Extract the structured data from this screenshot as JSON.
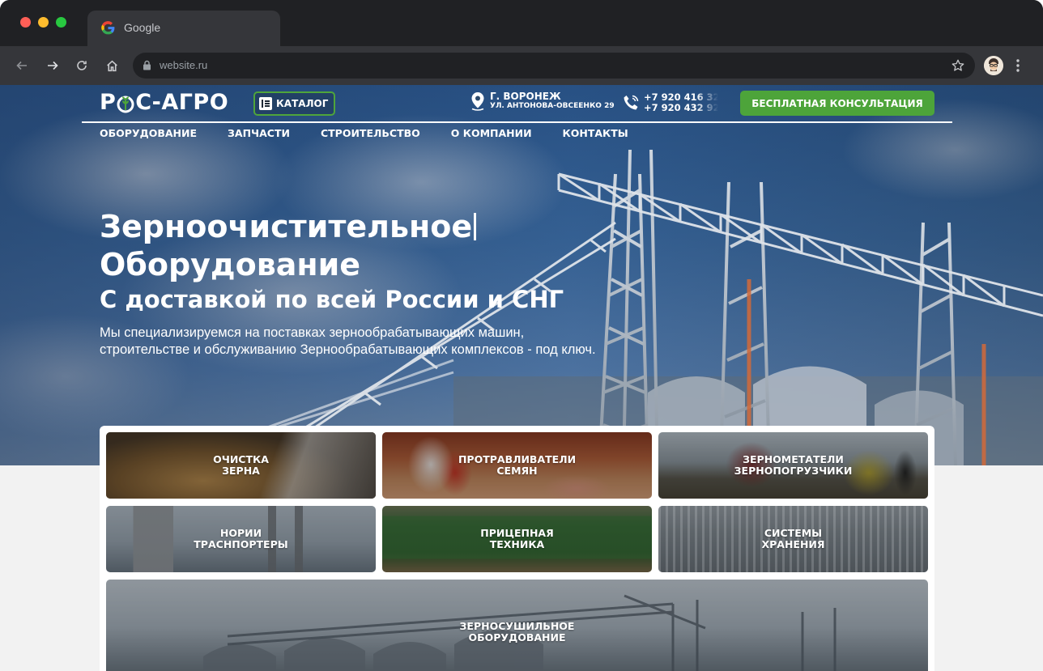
{
  "browser": {
    "tab_title": "Google",
    "url": "website.ru"
  },
  "site": {
    "logo_text_left": "Р",
    "logo_text_right": "С-АГРО",
    "catalog_label": "КАТАЛОГ",
    "address_city": "Г. ВОРОНЕЖ",
    "address_street": "УЛ. АНТОНОВА-ОВСЕЕНКО 29",
    "phone_1": "+7 920 416 323",
    "phone_2": "+7 920 432 929",
    "consult_label": "БЕСПЛАТНАЯ КОНСУЛЬТАЦИЯ",
    "nav": [
      {
        "label": "ОБОРУДОВАНИЕ"
      },
      {
        "label": "ЗАПЧАСТИ"
      },
      {
        "label": "СТРОИТЕЛЬСТВО"
      },
      {
        "label": "О КОМПАНИИ"
      },
      {
        "label": "КОНТАКТЫ"
      }
    ]
  },
  "hero": {
    "title_line1": "Зерноочистительное",
    "title_line2": "Оборудование",
    "subtitle": "С доставкой по всей России и СНГ",
    "lead_line1": "Мы специализируемся на поставках зернообрабатывающих машин,",
    "lead_line2": "строительстве и обслуживанию Зернообрабатывающих комплексов - под ключ."
  },
  "categories": [
    {
      "line1": "ОЧИСТКА",
      "line2": "ЗЕРНА"
    },
    {
      "line1": "ПРОТРАВЛИВАТЕЛИ",
      "line2": "СЕМЯН"
    },
    {
      "line1": "ЗЕРНОМЕТАТЕЛИ",
      "line2": "ЗЕРНОПОГРУЗЧИКИ"
    },
    {
      "line1": "НОРИИ",
      "line2": "ТРАСНПОРТЕРЫ"
    },
    {
      "line1": "ПРИЦЕПНАЯ",
      "line2": "ТЕХНИКА"
    },
    {
      "line1": "СИСТЕМЫ",
      "line2": "ХРАНЕНИЯ"
    },
    {
      "line1": "ЗЕРНОСУШИЛЬНОЕ",
      "line2": "ОБОРУДОВАНИЕ"
    }
  ],
  "icons": {
    "back": "arrow-left-icon",
    "forward": "arrow-right-icon",
    "reload": "reload-icon",
    "home": "home-icon",
    "lock": "lock-icon",
    "bookmark": "star-icon",
    "menu": "kebab-menu-icon",
    "location": "map-pin-icon",
    "phone": "phone-icon",
    "catalog": "book-icon"
  },
  "colors": {
    "accent_green": "#4da43a",
    "chrome_dark": "#202124",
    "chrome_toolbar": "#35363a"
  }
}
